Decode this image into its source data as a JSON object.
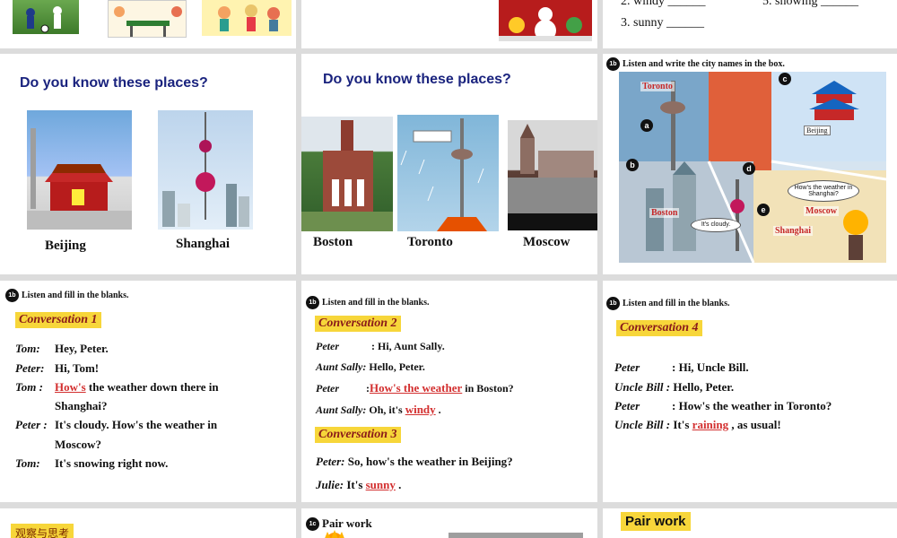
{
  "top_right": {
    "items": [
      {
        "num": "2. windy",
        "blank": "______"
      },
      {
        "num": "5. snowing",
        "blank": "______"
      },
      {
        "num": "3. sunny",
        "blank": "______"
      }
    ]
  },
  "places1": {
    "heading": "Do you know these places?",
    "captions": [
      "Beijing",
      "Shanghai"
    ]
  },
  "places2": {
    "heading": "Do you know these places?",
    "captions": [
      "Boston",
      "Toronto",
      "Moscow"
    ]
  },
  "map": {
    "badge": "1b",
    "instruction": "Listen and write the city names in the box.",
    "labels": {
      "toronto": "Toronto",
      "boston": "Boston",
      "moscow": "Moscow",
      "shanghai": "Shanghai",
      "beijing": "Beijing"
    },
    "letters": [
      "a",
      "b",
      "c",
      "d",
      "e"
    ],
    "bubbles": {
      "weather": "How's the weather in Shanghai?",
      "cloudy": "It's cloudy."
    }
  },
  "conv1": {
    "badge": "1b",
    "instruction": "Listen and fill in the blanks.",
    "title": "Conversation 1",
    "lines": [
      {
        "speaker": "Tom:",
        "text": "Hey, Peter."
      },
      {
        "speaker": "Peter:",
        "text": "Hi, Tom!"
      },
      {
        "speaker": "Tom :",
        "answer": "How's",
        "text": "the weather down there in"
      },
      {
        "speaker": "",
        "text": "Shanghai?"
      },
      {
        "speaker": "Peter :",
        "text": "It's cloudy. How's the weather in"
      },
      {
        "speaker": "",
        "text": "Moscow?"
      },
      {
        "speaker": "Tom:",
        "text": "It's snowing right now."
      }
    ]
  },
  "conv23": {
    "badge": "1b",
    "instruction": "Listen and fill in the blanks.",
    "title2": "Conversation 2",
    "l1": {
      "speaker": "Peter",
      "text": ": Hi, Aunt Sally."
    },
    "l2": {
      "speaker": "Aunt Sally:",
      "text": "Hello, Peter."
    },
    "l3": {
      "speaker": "Peter",
      "pre": ":",
      "answer": "How's the weather",
      "text": "in Boston?"
    },
    "l4": {
      "speaker": "Aunt Sally:",
      "pre": "Oh, it's",
      "answer": "windy",
      "text": "."
    },
    "title3": "Conversation 3",
    "l5": {
      "speaker": "Peter:",
      "text": "So, how's the weather in Beijing?"
    },
    "l6": {
      "speaker": "Julie:",
      "pre": "It's",
      "answer": "sunny",
      "text": "."
    }
  },
  "conv4": {
    "badge": "1b",
    "instruction": "Listen and fill in the blanks.",
    "title": "Conversation 4",
    "l1": {
      "speaker": "Peter",
      "text": ": Hi, Uncle Bill."
    },
    "l2": {
      "speaker": "Uncle Bill :",
      "text": "Hello, Peter."
    },
    "l3": {
      "speaker": "Peter",
      "text": ": How's the weather in Toronto?"
    },
    "l4": {
      "speaker": "Uncle Bill :",
      "pre": "It's",
      "answer": "raining",
      "text": ", as usual!"
    }
  },
  "bottom": {
    "left_label": "观察与思考",
    "mid_badge": "1c",
    "mid_title": "Pair work",
    "right_title": "Pair work"
  },
  "colors": {
    "accent_yellow": "#f7d63a",
    "answer_red": "#d32f2f",
    "heading_navy": "#1a237e"
  }
}
